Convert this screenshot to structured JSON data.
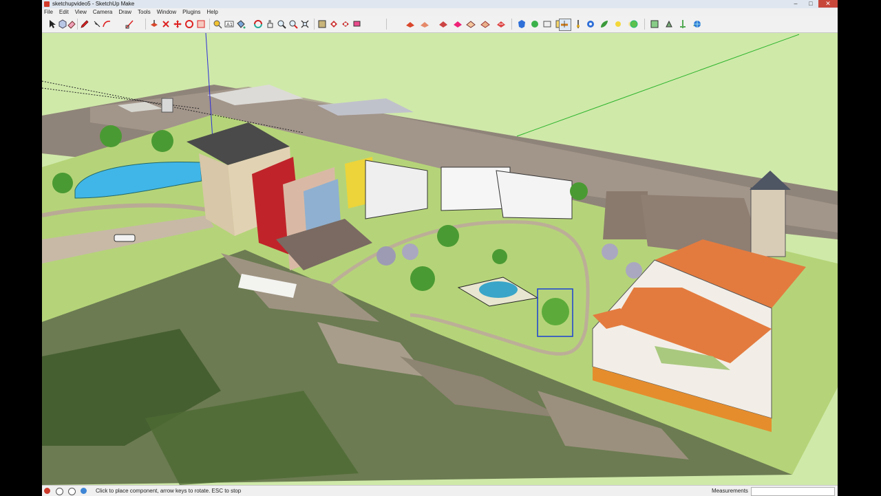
{
  "window": {
    "title": "sketchupvideo5 - SketchUp Make",
    "controls": {
      "minimize": "–",
      "maximize": "□",
      "close": "✕"
    }
  },
  "menu": [
    "File",
    "Edit",
    "View",
    "Camera",
    "Draw",
    "Tools",
    "Window",
    "Plugins",
    "Help"
  ],
  "toolbar": {
    "tools": [
      "select-icon",
      "component-icon",
      "eraser-icon",
      "pencil-icon",
      "line-icon",
      "arc-icon",
      "rectangle-icon",
      "push-pull-icon",
      "move-icon",
      "rotate-icon",
      "scale-icon",
      "tape-measure-icon",
      "text-icon",
      "paint-bucket-icon",
      "orbit-icon",
      "pan-icon",
      "zoom-icon",
      "zoom-extents-icon",
      "warehouse-icon",
      "components-icon",
      "materials-icon",
      "styles-icon",
      "layers-icon",
      "scenes-icon",
      "shadows-icon",
      "sandbox-icon",
      "terrain-icon",
      "geolocate-icon",
      "section-icon",
      "sun-icon",
      "fog-icon",
      "photo-icon",
      "layout-icon",
      "extensions-icon",
      "help-icon"
    ]
  },
  "status": {
    "hint": "Click to place component, arrow keys to rotate. ESC to stop",
    "measurements_label": "Measurements",
    "measurements_value": ""
  },
  "colors": {
    "ground": "#b9d67c",
    "sky": "#cfe9a9",
    "water": "#3fb4e6",
    "roof_orange": "#e37b3f",
    "selection_blue": "#1a3fd6"
  }
}
